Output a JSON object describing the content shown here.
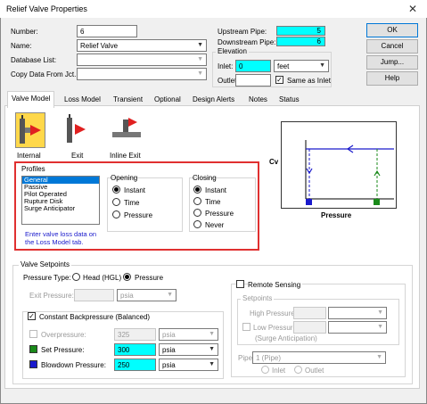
{
  "window": {
    "title": "Relief Valve Properties",
    "close": "✕"
  },
  "header": {
    "number_label": "Number:",
    "number_value": "6",
    "name_label": "Name:",
    "name_value": "Relief Valve",
    "db_label": "Database List:",
    "db_value": "",
    "copy_label": "Copy Data From Jct...",
    "copy_value": ""
  },
  "pipes": {
    "upstream_label": "Upstream Pipe:",
    "upstream_value": "5",
    "downstream_label": "Downstream Pipe:",
    "downstream_value": "6"
  },
  "elevation": {
    "group_label": "Elevation",
    "inlet_label": "Inlet:",
    "inlet_value": "0",
    "unit": "feet",
    "outlet_label": "Outlet:",
    "outlet_value": "",
    "same_label": "Same as Inlet",
    "same_checked": "✓"
  },
  "buttons": {
    "ok": "OK",
    "cancel": "Cancel",
    "jump": "Jump...",
    "help": "Help"
  },
  "tabs": [
    {
      "label": "Valve Model"
    },
    {
      "label": "Loss Model"
    },
    {
      "label": "Transient"
    },
    {
      "label": "Optional"
    },
    {
      "label": "Design Alerts"
    },
    {
      "label": "Notes"
    },
    {
      "label": "Status"
    }
  ],
  "valve_types": [
    {
      "label": "Internal"
    },
    {
      "label": "Exit"
    },
    {
      "label": "Inline Exit"
    }
  ],
  "profiles": {
    "group_label": "Profiles",
    "items": [
      "General",
      "Passive",
      "Pilot Operated",
      "Rupture Disk",
      "Surge Anticipator"
    ],
    "note": "Enter valve loss data on the Loss Model tab."
  },
  "opening": {
    "label": "Opening",
    "options": [
      "Instant",
      "Time",
      "Pressure"
    ]
  },
  "closing": {
    "label": "Closing",
    "options": [
      "Instant",
      "Time",
      "Pressure",
      "Never"
    ]
  },
  "graph": {
    "y_label": "Cv",
    "x_label": "Pressure"
  },
  "setpoints": {
    "group_label": "Valve Setpoints",
    "pressure_type_label": "Pressure Type:",
    "head_label": "Head (HGL)",
    "pressure_label": "Pressure",
    "exit_pressure_label": "Exit Pressure:",
    "exit_pressure_value": "",
    "exit_unit": "psia",
    "const_bp_label": "Constant Backpressure (Balanced)",
    "const_bp_checked": "✓",
    "overpressure_label": "Overpressure:",
    "overpressure_value": "325",
    "overpressure_unit": "psia",
    "set_label": "Set Pressure:",
    "set_value": "300",
    "set_unit": "psia",
    "blowdown_label": "Blowdown Pressure:",
    "blowdown_value": "250",
    "blowdown_unit": "psia",
    "set_color": "#1a8a1a",
    "blowdown_color": "#1a1acc"
  },
  "remote": {
    "label": "Remote Sensing",
    "setpoints_label": "Setpoints",
    "high_label": "High Pressure:",
    "low_label": "Low Pressure:",
    "surge_label": "(Surge Anticipation)",
    "pipe_label": "Pipe:",
    "pipe_value": "1 (Pipe)",
    "inlet_label": "Inlet",
    "outlet_label": "Outlet"
  }
}
